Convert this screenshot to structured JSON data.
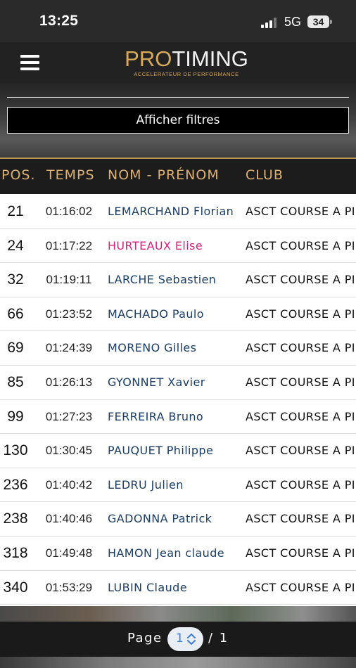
{
  "status_bar": {
    "time": "13:25",
    "network": "5G",
    "battery": "34"
  },
  "header": {
    "logo_pro": "PRO",
    "logo_timing": "TIMING",
    "logo_tagline": "ACCELERATEUR DE PERFORMANCE",
    "menu_icon": "hamburger-icon"
  },
  "filters": {
    "button_label": "Afficher filtres"
  },
  "table": {
    "columns": [
      "POS.",
      "TEMPS",
      "NOM - PRÉNOM",
      "CLUB"
    ],
    "rows": [
      {
        "pos": "21",
        "time": "01:16:02",
        "name": "LEMARCHAND Florian",
        "club": "ASCT COURSE A PIE",
        "female": false
      },
      {
        "pos": "24",
        "time": "01:17:22",
        "name": "HURTEAUX Elise",
        "club": "ASCT COURSE A PIE",
        "female": true
      },
      {
        "pos": "32",
        "time": "01:19:11",
        "name": "LARCHE Sebastien",
        "club": "ASCT COURSE A PIE",
        "female": false
      },
      {
        "pos": "66",
        "time": "01:23:52",
        "name": "MACHADO Paulo",
        "club": "ASCT COURSE A PIE",
        "female": false
      },
      {
        "pos": "69",
        "time": "01:24:39",
        "name": "MORENO Gilles",
        "club": "ASCT COURSE A PIE",
        "female": false
      },
      {
        "pos": "85",
        "time": "01:26:13",
        "name": "GYONNET Xavier",
        "club": "ASCT COURSE A PIE",
        "female": false
      },
      {
        "pos": "99",
        "time": "01:27:23",
        "name": "FERREIRA Bruno",
        "club": "ASCT COURSE A PIE",
        "female": false
      },
      {
        "pos": "130",
        "time": "01:30:45",
        "name": "PAUQUET Philippe",
        "club": "ASCT COURSE A PIE",
        "female": false
      },
      {
        "pos": "236",
        "time": "01:40:42",
        "name": "LEDRU Julien",
        "club": "ASCT COURSE A PIE",
        "female": false
      },
      {
        "pos": "238",
        "time": "01:40:46",
        "name": "GADONNA Patrick",
        "club": "ASCT COURSE A PIE",
        "female": false
      },
      {
        "pos": "318",
        "time": "01:49:48",
        "name": "HAMON Jean claude",
        "club": "ASCT COURSE A PIE",
        "female": false
      },
      {
        "pos": "340",
        "time": "01:53:29",
        "name": "LUBIN Claude",
        "club": "ASCT COURSE A PIE",
        "female": false
      }
    ]
  },
  "colors": {
    "accent_gold": "#dcb071",
    "name_blue": "#1b3d66",
    "name_female": "#d4217c"
  },
  "pagination": {
    "label": "Page",
    "current": "1",
    "total": "/ 1"
  }
}
